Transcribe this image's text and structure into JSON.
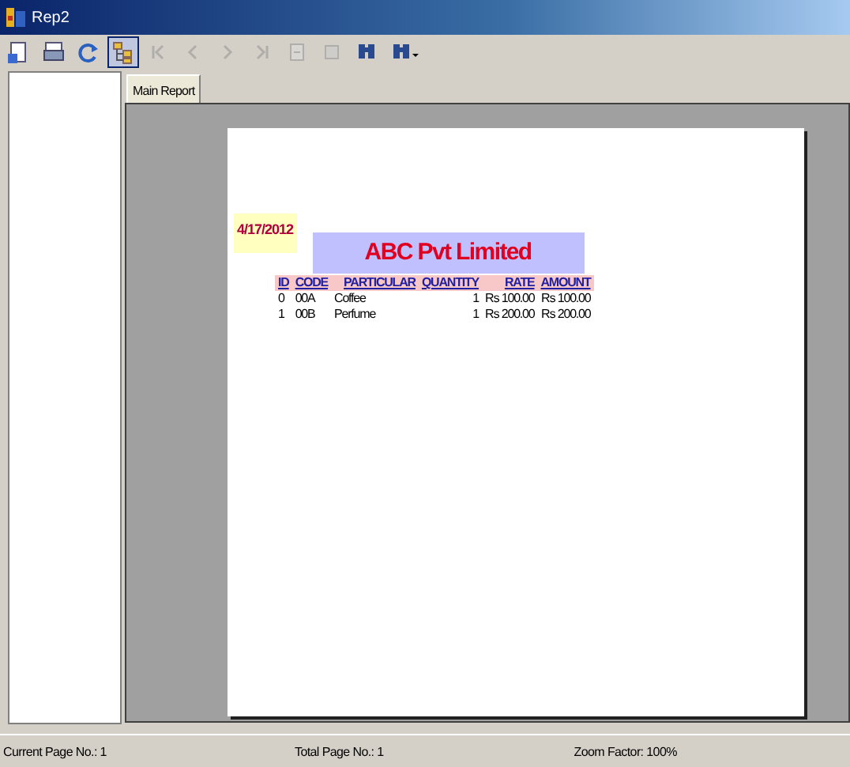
{
  "window": {
    "title": "Rep2"
  },
  "toolbar": [
    {
      "kind": "export",
      "disabled": false,
      "selected": false
    },
    {
      "kind": "print",
      "disabled": false,
      "selected": false
    },
    {
      "kind": "refresh",
      "disabled": false,
      "selected": false
    },
    {
      "kind": "tree",
      "disabled": false,
      "selected": true
    },
    {
      "kind": "first",
      "disabled": true,
      "selected": false
    },
    {
      "kind": "prev",
      "disabled": true,
      "selected": false
    },
    {
      "kind": "next",
      "disabled": true,
      "selected": false
    },
    {
      "kind": "last",
      "disabled": true,
      "selected": false
    },
    {
      "kind": "goto",
      "disabled": true,
      "selected": false
    },
    {
      "kind": "stop",
      "disabled": true,
      "selected": false
    },
    {
      "kind": "search",
      "disabled": false,
      "selected": false
    },
    {
      "kind": "zoom",
      "disabled": false,
      "selected": false
    }
  ],
  "tabs": [
    {
      "label": "Main Report",
      "selected": true
    }
  ],
  "report": {
    "date": "4/17/2012",
    "title": "ABC Pvt Limited",
    "columns": [
      "ID",
      "CODE",
      "PARTICULAR",
      "QUANTITY",
      "RATE",
      "AMOUNT"
    ],
    "rows": [
      [
        "0",
        "00A",
        "Coffee",
        "1",
        "₨ 100.00",
        "₨ 100.00"
      ],
      [
        "1",
        "00B",
        "Perfume",
        "1",
        "₨ 200.00",
        "₨ 200.00"
      ]
    ]
  },
  "status_bar": [
    "Current Page No.: 1",
    "Total Page No.: 1",
    "Zoom Factor: 100%"
  ]
}
